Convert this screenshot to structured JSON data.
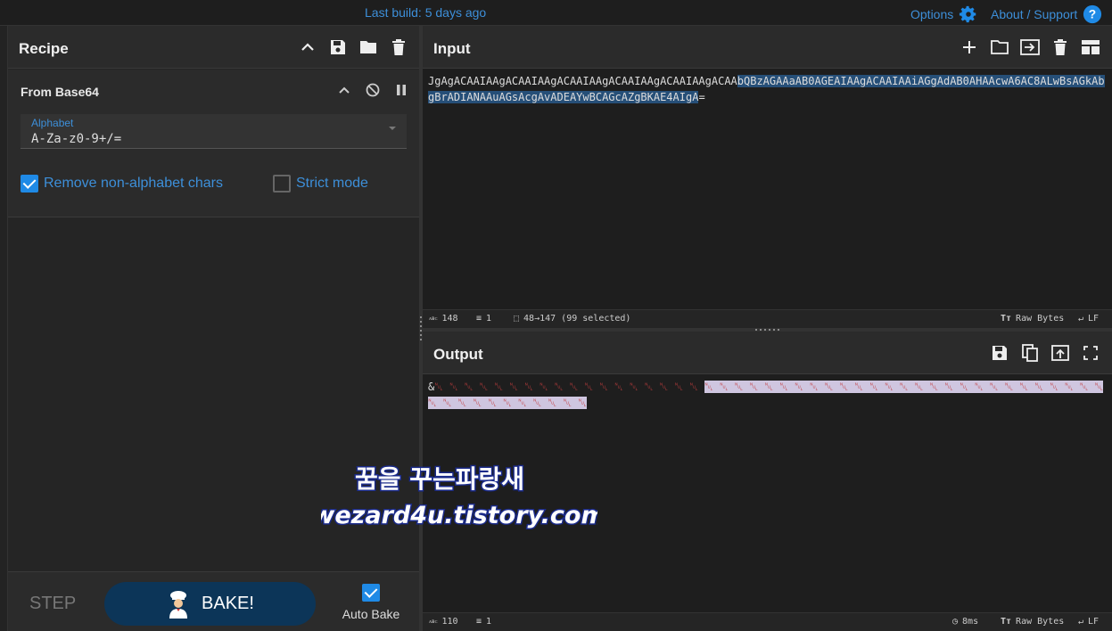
{
  "topbar": {
    "build": "Last build: 5 days ago",
    "options": "Options",
    "about": "About / Support"
  },
  "recipe": {
    "title": "Recipe",
    "operation": {
      "name": "From Base64",
      "alphabet_label": "Alphabet",
      "alphabet_value": "A-Za-z0-9+/=",
      "remove_label": "Remove non-alphabet chars",
      "remove_checked": true,
      "strict_label": "Strict mode",
      "strict_checked": false
    },
    "footer": {
      "step": "STEP",
      "bake": "BAKE!",
      "auto_bake": "Auto Bake",
      "auto_checked": true
    }
  },
  "input": {
    "title": "Input",
    "text_plain": "JgAgACAAIAAgACAAIAAgACAAIAAgACAAIAAgACAAIAAgACAA",
    "text_selected": "bQBzAGAAaAB0AGEAIAAgACAAIAAiAGgAdAB0AHAAcwA6AC8ALwBsAGkAbgBrADIANAAuAGsAcgAvADEAYwBCAGcAZgBKAE4AIgA",
    "text_tail": "=",
    "status": {
      "length": "148",
      "lines": "1",
      "selection": "48→147 (99 selected)",
      "raw": "Raw Bytes",
      "eol": "LF"
    }
  },
  "output": {
    "title": "Output",
    "prefix": "&",
    "status": {
      "length": "110",
      "lines": "1",
      "time": "8ms",
      "raw": "Raw Bytes",
      "eol": "LF"
    }
  },
  "watermark": {
    "line1": "꿈을 꾸는파랑새",
    "line2": "wezard4u.tistory.com"
  }
}
